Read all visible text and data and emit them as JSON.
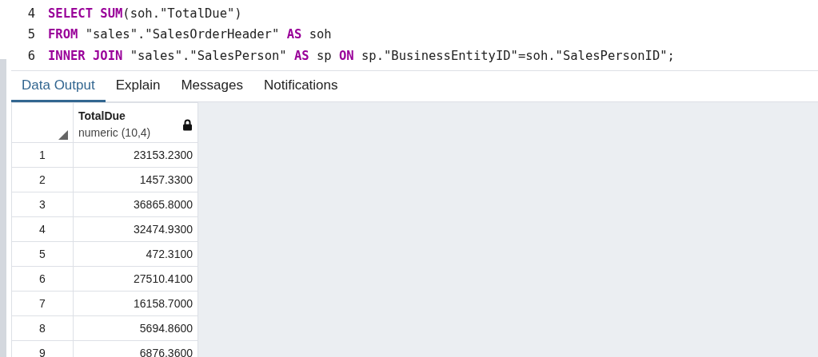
{
  "editor": {
    "lines": [
      {
        "number": "4",
        "tokens": [
          {
            "kind": "keyword",
            "text": "SELECT SUM"
          },
          {
            "kind": "plain",
            "text": "(soh.\"TotalDue\")"
          }
        ]
      },
      {
        "number": "5",
        "tokens": [
          {
            "kind": "keyword",
            "text": "FROM"
          },
          {
            "kind": "plain",
            "text": " \"sales\".\"SalesOrderHeader\" "
          },
          {
            "kind": "keyword",
            "text": "AS"
          },
          {
            "kind": "plain",
            "text": " soh"
          }
        ]
      },
      {
        "number": "6",
        "tokens": [
          {
            "kind": "keyword",
            "text": "INNER JOIN"
          },
          {
            "kind": "plain",
            "text": " \"sales\".\"SalesPerson\" "
          },
          {
            "kind": "keyword",
            "text": "AS"
          },
          {
            "kind": "plain",
            "text": " sp "
          },
          {
            "kind": "keyword",
            "text": "ON"
          },
          {
            "kind": "plain",
            "text": " sp.\"BusinessEntityID\"=soh.\"SalesPersonID\";"
          }
        ]
      }
    ]
  },
  "tabs": [
    {
      "label": "Data Output",
      "selected": true
    },
    {
      "label": "Explain",
      "selected": false
    },
    {
      "label": "Messages",
      "selected": false
    },
    {
      "label": "Notifications",
      "selected": false
    }
  ],
  "table": {
    "columns": [
      {
        "name": "TotalDue",
        "type": "numeric (10,4)",
        "locked": true
      }
    ],
    "rows": [
      {
        "number": "1",
        "values": [
          "23153.2300"
        ]
      },
      {
        "number": "2",
        "values": [
          "1457.3300"
        ]
      },
      {
        "number": "3",
        "values": [
          "36865.8000"
        ]
      },
      {
        "number": "4",
        "values": [
          "32474.9300"
        ]
      },
      {
        "number": "5",
        "values": [
          "472.3100"
        ]
      },
      {
        "number": "6",
        "values": [
          "27510.4100"
        ]
      },
      {
        "number": "7",
        "values": [
          "16158.7000"
        ]
      },
      {
        "number": "8",
        "values": [
          "5694.8600"
        ]
      },
      {
        "number": "9",
        "values": [
          "6876.3600"
        ]
      }
    ]
  }
}
